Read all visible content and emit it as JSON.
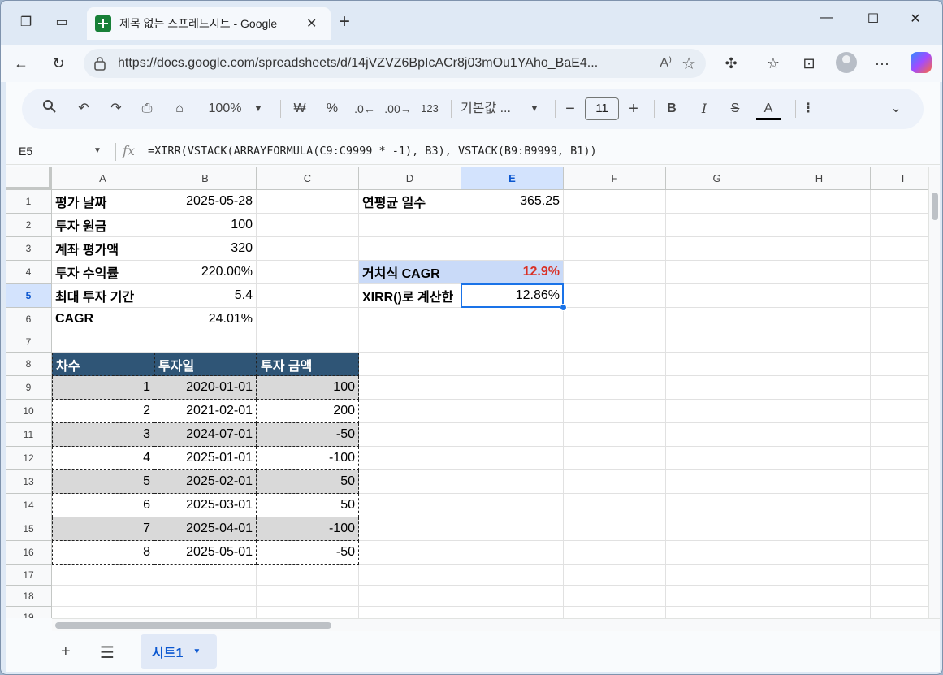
{
  "browser": {
    "tab_title": "제목 없는 스프레드시트 - Google",
    "url": "https://docs.google.com/spreadsheets/d/14jVZVZ6BpIcACr8j03mOu1YAho_BaE4..."
  },
  "toolbar": {
    "zoom": "100%",
    "currency": "₩",
    "percent": "%",
    "decrease_decimal": ".0",
    "increase_decimal": ".00",
    "number_format": "123",
    "font": "기본값 ...",
    "font_size": "11",
    "bold": "B",
    "italic": "I",
    "text_color": "A"
  },
  "formula_bar": {
    "name_box": "E5",
    "formula": "=XIRR(VSTACK(ARRAYFORMULA(C9:C9999 * -1), B3), VSTACK(B9:B9999, B1))"
  },
  "columns": [
    "A",
    "B",
    "C",
    "D",
    "E",
    "F",
    "G",
    "H",
    "I"
  ],
  "rows": [
    "1",
    "2",
    "3",
    "4",
    "5",
    "6",
    "7",
    "8",
    "9",
    "10",
    "11",
    "12",
    "13",
    "14",
    "15",
    "16",
    "17",
    "18",
    "19"
  ],
  "cells": {
    "A1": "평가 날짜",
    "B1": "2025-05-28",
    "D1": "연평균 일수",
    "E1": "365.25",
    "A2": "투자 원금",
    "B2": "100",
    "A3": "계좌 평가액",
    "B3": "320",
    "A4": "투자 수익률",
    "B4": "220.00%",
    "D4": "거치식 CAGR",
    "E4": "12.9%",
    "A5": "최대 투자 기간",
    "B5": "5.4",
    "D5": "XIRR()로 계산한",
    "E5": "12.86%",
    "A6": "CAGR",
    "B6": "24.01%",
    "A8": "차수",
    "B8": "투자일",
    "C8": "투자 금액",
    "A9": "1",
    "B9": "2020-01-01",
    "C9": "100",
    "A10": "2",
    "B10": "2021-02-01",
    "C10": "200",
    "A11": "3",
    "B11": "2024-07-01",
    "C11": "-50",
    "A12": "4",
    "B12": "2025-01-01",
    "C12": "-100",
    "A13": "5",
    "B13": "2025-02-01",
    "C13": "50",
    "A14": "6",
    "B14": "2025-03-01",
    "C14": "50",
    "A15": "7",
    "B15": "2025-04-01",
    "C15": "-100",
    "A16": "8",
    "B16": "2025-05-01",
    "C16": "-50"
  },
  "sheet_tabs": [
    "시트1"
  ],
  "colors": {
    "header_fill": "#2f5576",
    "accent_blue": "#c9daf8",
    "cagr_red": "#d93025"
  }
}
